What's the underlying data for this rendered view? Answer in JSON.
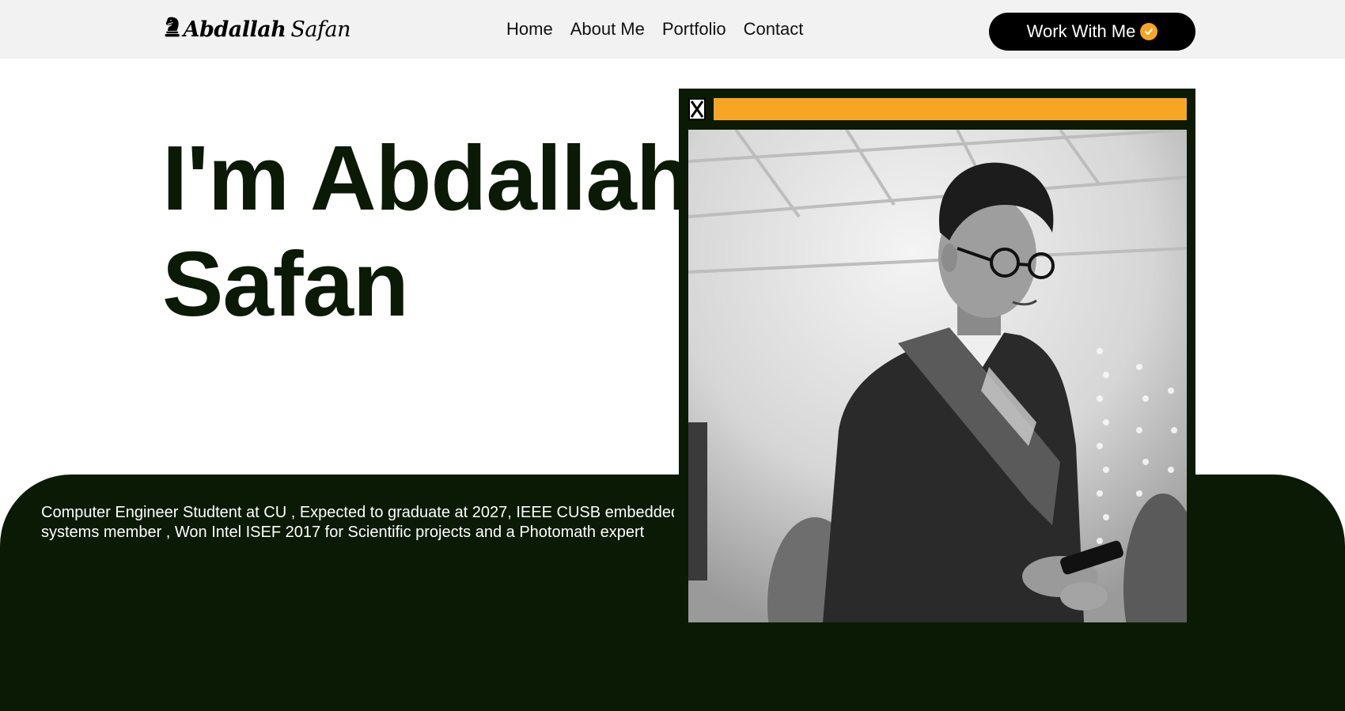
{
  "brand": {
    "first_name": "Abdallah",
    "last_name": "Safan",
    "logo_icon": "chess-knight-icon"
  },
  "nav": {
    "links": [
      "Home",
      "About Me",
      "Portfolio",
      "Contact"
    ]
  },
  "cta": {
    "label": "Work With Me",
    "icon": "check-circle-icon",
    "icon_color": "#f6a623"
  },
  "hero": {
    "title_line1": "I'm Abdallah",
    "title_line2": "Safan"
  },
  "bio": {
    "line1": "Computer Engineer Studtent at CU , Expected to graduate at 2027, IEEE CUSB embedded",
    "line2": "systems member , Won Intel ISEF 2017 for Scientific projects and a Photomath expert"
  },
  "photo_window": {
    "close_icon": "close-icon",
    "bar_color": "#f6a623",
    "frame_color": "#0b1a04"
  },
  "colors": {
    "accent": "#f6a623",
    "dark": "#0b1a04",
    "nav_bg": "#f2f2f2"
  }
}
